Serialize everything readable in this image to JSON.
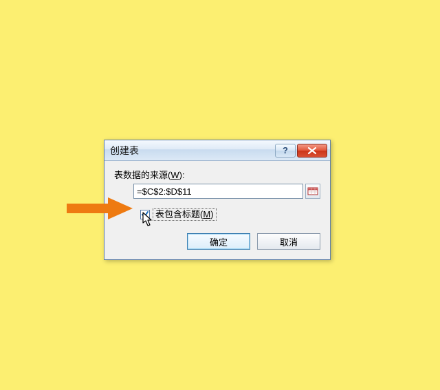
{
  "dialog": {
    "title": "创建表",
    "source_label_prefix": "表数据的来源(",
    "source_label_accel": "W",
    "source_label_suffix": "):",
    "range_value": "=$C$2:$D$11",
    "headers_checked": true,
    "headers_label_prefix": "表包含标题(",
    "headers_label_accel": "M",
    "headers_label_suffix": ")",
    "ok_label": "确定",
    "cancel_label": "取消",
    "help_label": "?"
  },
  "colors": {
    "arrow": "#ee7a11"
  }
}
